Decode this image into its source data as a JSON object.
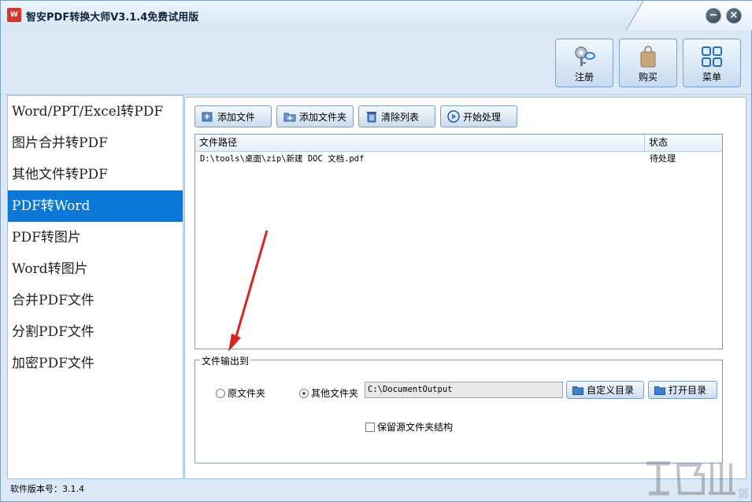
{
  "window": {
    "title": "智安PDF转换大师V3.1.4免费试用版",
    "app_icon_text": "W",
    "minimize_label": "−",
    "close_label": "×"
  },
  "topbar": {
    "register": "注册",
    "buy": "购买",
    "menu": "菜单"
  },
  "sidebar": {
    "items": [
      {
        "label": "Word/PPT/Excel转PDF"
      },
      {
        "label": "图片合并转PDF"
      },
      {
        "label": "其他文件转PDF"
      },
      {
        "label": "PDF转Word"
      },
      {
        "label": "PDF转图片"
      },
      {
        "label": "Word转图片"
      },
      {
        "label": "合并PDF文件"
      },
      {
        "label": "分割PDF文件"
      },
      {
        "label": "加密PDF文件"
      }
    ],
    "active_index": 3
  },
  "toolbar": {
    "add_file": "添加文件",
    "add_folder": "添加文件夹",
    "clear_list": "清除列表",
    "start": "开始处理"
  },
  "filelist": {
    "headers": {
      "path": "文件路径",
      "status": "状态"
    },
    "rows": [
      {
        "path": "D:\\tools\\桌面\\zip\\新建 DOC 文档.pdf",
        "status": "待处理"
      }
    ]
  },
  "output": {
    "legend": "文件输出到",
    "radio_original": "原文件夹",
    "radio_other": "其他文件夹",
    "selected": "other",
    "path_value": "C:\\DocumentOutput",
    "custom_dir_button": "自定义目录",
    "open_dir_button": "打开目录",
    "keep_structure_label": "保留源文件夹结构",
    "keep_structure_checked": false
  },
  "statusbar": {
    "version_text": "软件版本号：3.1.4"
  },
  "colors": {
    "active_item": "#0a78d7",
    "annotation_arrow": "#d9231f"
  }
}
